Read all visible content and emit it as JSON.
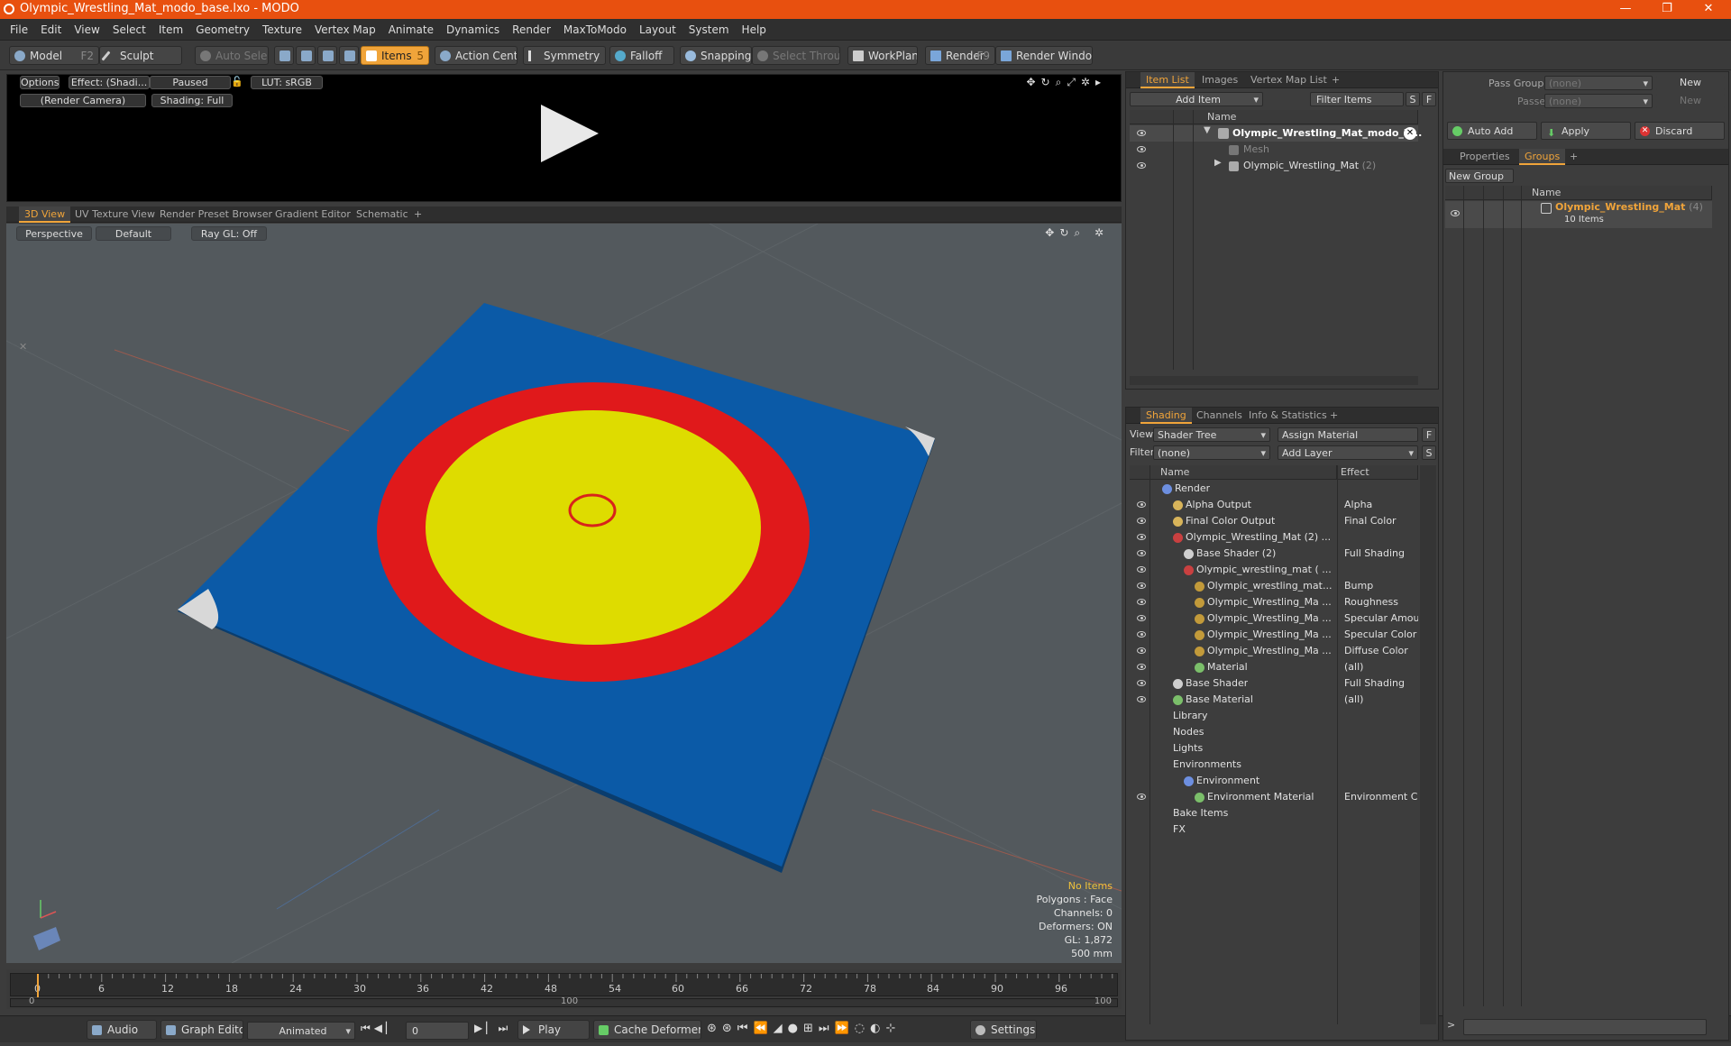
{
  "window": {
    "title": "Olympic_Wrestling_Mat_modo_base.lxo - MODO",
    "min": "—",
    "max": "❐",
    "close": "✕"
  },
  "menu": [
    "File",
    "Edit",
    "View",
    "Select",
    "Item",
    "Geometry",
    "Texture",
    "Vertex Map",
    "Animate",
    "Dynamics",
    "Render",
    "MaxToModo",
    "Layout",
    "System",
    "Help"
  ],
  "toolbar": {
    "model": "Model",
    "model_key": "F2",
    "sculpt": "Sculpt",
    "auto_select": "Auto Select",
    "items": "Items",
    "items_key": "5",
    "action_center": "Action Center",
    "symmetry": "Symmetry",
    "falloff": "Falloff",
    "snapping": "Snapping",
    "select_through": "Select Through",
    "workplane": "WorkPlane",
    "render": "Render",
    "render_key": "F9",
    "render_window": "Render Window"
  },
  "preview": {
    "options": "Options",
    "effect": "Effect: (Shadi...",
    "paused": "Paused",
    "lut": "LUT: sRGB",
    "camera": "(Render Camera)",
    "shading": "Shading: Full"
  },
  "viewport_tabs": [
    "3D View",
    "UV Texture View",
    "Render Preset Browser",
    "Gradient Editor",
    "Schematic",
    "+"
  ],
  "viewport": {
    "perspective": "Perspective",
    "default": "Default",
    "raygl": "Ray GL: Off",
    "stats": [
      "No Items",
      "Polygons : Face",
      "Channels: 0",
      "Deformers: ON",
      "GL: 1,872",
      "500 mm"
    ]
  },
  "timeline": {
    "ticks": [
      "0",
      "6",
      "12",
      "18",
      "24",
      "30",
      "36",
      "42",
      "48",
      "54",
      "60",
      "66",
      "72",
      "78",
      "84",
      "90",
      "96"
    ],
    "sub": [
      "0",
      "100",
      "100"
    ]
  },
  "bottom": {
    "audio": "Audio",
    "graph_editor": "Graph Editor",
    "animated": "Animated",
    "frame": "0",
    "play": "Play",
    "cache": "Cache Deformers",
    "settings": "Settings"
  },
  "item_list": {
    "tabs": [
      "Item List",
      "Images",
      "Vertex Map List",
      "+"
    ],
    "add_item": "Add Item",
    "filter": "Filter Items",
    "s": "S",
    "f": "F",
    "col_name": "Name",
    "rows": [
      {
        "label": "Olympic_Wrestling_Mat_modo_b...",
        "indent": 0,
        "bold": true
      },
      {
        "label": "Mesh",
        "indent": 1,
        "dim": true
      },
      {
        "label": "Olympic_Wrestling_Mat",
        "count": "(2)",
        "indent": 1
      }
    ]
  },
  "shading": {
    "tabs": [
      "Shading",
      "Channels",
      "Info & Statistics",
      "+"
    ],
    "view_label": "View",
    "view_value": "Shader Tree",
    "assign": "Assign Material",
    "f": "F",
    "filter_label": "Filter",
    "filter_value": "(none)",
    "add_layer": "Add Layer",
    "s": "S",
    "col_name": "Name",
    "col_effect": "Effect",
    "rows": [
      {
        "label": "Render",
        "effect": "",
        "ind": 0,
        "color": "#6d8fe0",
        "eye": false
      },
      {
        "label": "Alpha Output",
        "effect": "Alpha",
        "ind": 1,
        "color": "#d8b45a",
        "eye": true
      },
      {
        "label": "Final Color Output",
        "effect": "Final Color",
        "ind": 1,
        "color": "#d8b45a",
        "eye": true
      },
      {
        "label": "Olympic_Wrestling_Mat (2) ...",
        "effect": "",
        "ind": 1,
        "color": "#c94040",
        "eye": true
      },
      {
        "label": "Base Shader (2)",
        "effect": "Full Shading",
        "ind": 2,
        "color": "#cfcfcf",
        "eye": true
      },
      {
        "label": "Olympic_wrestling_mat ( ...",
        "effect": "",
        "ind": 2,
        "color": "#c94040",
        "eye": true
      },
      {
        "label": "Olympic_wrestling_mat...",
        "effect": "Bump",
        "ind": 3,
        "color": "#c29a3a",
        "eye": true
      },
      {
        "label": "Olympic_Wrestling_Ma ...",
        "effect": "Roughness",
        "ind": 3,
        "color": "#c29a3a",
        "eye": true
      },
      {
        "label": "Olympic_Wrestling_Ma ...",
        "effect": "Specular Amount",
        "ind": 3,
        "color": "#c29a3a",
        "eye": true
      },
      {
        "label": "Olympic_Wrestling_Ma ...",
        "effect": "Specular Color",
        "ind": 3,
        "color": "#c29a3a",
        "eye": true
      },
      {
        "label": "Olympic_Wrestling_Ma ...",
        "effect": "Diffuse Color",
        "ind": 3,
        "color": "#c29a3a",
        "eye": true
      },
      {
        "label": "Material",
        "effect": "(all)",
        "ind": 3,
        "color": "#7bbf6a",
        "eye": true
      },
      {
        "label": "Base Shader",
        "effect": "Full Shading",
        "ind": 1,
        "color": "#cfcfcf",
        "eye": true
      },
      {
        "label": "Base Material",
        "effect": "(all)",
        "ind": 1,
        "color": "#7bbf6a",
        "eye": true
      },
      {
        "label": "Library",
        "effect": "",
        "ind": 1,
        "color": "",
        "eye": false
      },
      {
        "label": "Nodes",
        "effect": "",
        "ind": 1,
        "color": "",
        "eye": false
      },
      {
        "label": "Lights",
        "effect": "",
        "ind": 1,
        "color": "",
        "eye": false
      },
      {
        "label": "Environments",
        "effect": "",
        "ind": 1,
        "color": "",
        "eye": false
      },
      {
        "label": "Environment",
        "effect": "",
        "ind": 2,
        "color": "#6d8fe0",
        "eye": false
      },
      {
        "label": "Environment Material",
        "effect": "Environment Color",
        "ind": 3,
        "color": "#7bbf6a",
        "eye": true
      },
      {
        "label": "Bake Items",
        "effect": "",
        "ind": 1,
        "color": "",
        "eye": false
      },
      {
        "label": "FX",
        "effect": "",
        "ind": 1,
        "color": "",
        "eye": false
      }
    ]
  },
  "groups": {
    "pass_groups": "Pass Groups",
    "passes": "Passes",
    "none": "(none)",
    "new": "New",
    "auto_add": "Auto Add",
    "apply": "Apply",
    "discard": "Discard",
    "tabs": [
      "Properties",
      "Groups",
      "+"
    ],
    "new_group": "New Group",
    "col_name": "Name",
    "group_name": "Olympic_Wrestling_Mat",
    "group_count": "(4)",
    "group_items": "10 Items"
  },
  "colors": {
    "accent": "#f0a43a",
    "title_bar": "#e8500f",
    "mat_blue": "#0b5aa7",
    "mat_red": "#e0191b",
    "mat_yellow": "#dedc00"
  }
}
